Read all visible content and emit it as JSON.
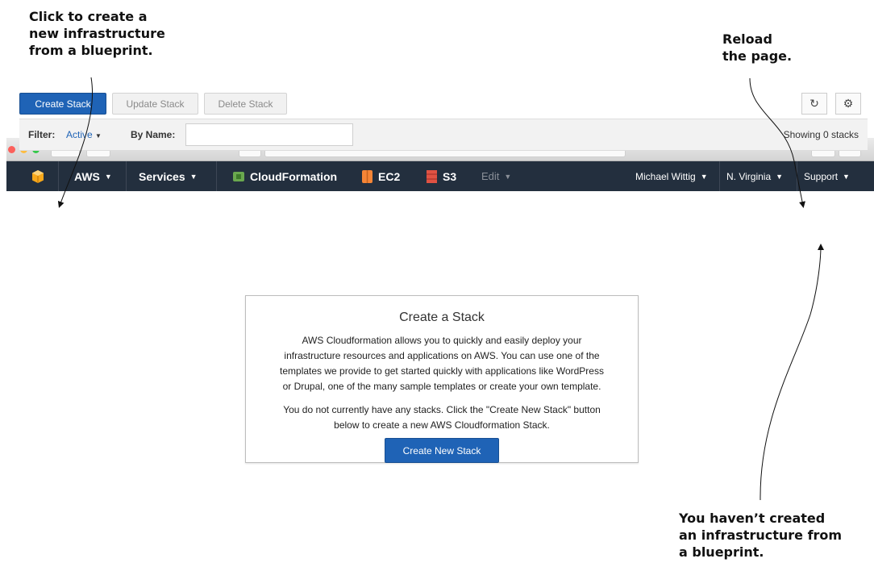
{
  "annotations": {
    "create_callout": "Click to create a\nnew infrastructure\nfrom a blueprint.",
    "reload_callout": "Reload\nthe page.",
    "empty_callout": "You haven’t created\nan infrastructure from\na blueprint."
  },
  "navbar": {
    "aws": "AWS",
    "services": "Services",
    "cloudformation": "CloudFormation",
    "ec2": "EC2",
    "s3": "S3",
    "edit": "Edit",
    "user": "Michael Wittig",
    "region": "N. Virginia",
    "support": "Support"
  },
  "toolbar": {
    "create": "Create Stack",
    "update": "Update Stack",
    "delete": "Delete Stack",
    "reload_icon": "refresh-icon",
    "settings_icon": "gear-icon"
  },
  "filter": {
    "label": "Filter:",
    "value": "Active",
    "by_name": "By Name:",
    "name_value": "",
    "count": "Showing 0 stacks"
  },
  "panel": {
    "title": "Create a Stack",
    "description": "AWS Cloudformation allows you to quickly and easily deploy your\ninfrastructure resources and applications on AWS. You can use one of the\ntemplates we provide to get started quickly with applications like WordPress\nor Drupal, one of the many sample templates or create your own template.",
    "empty_message": "You do not currently have any stacks. Click the \"Create New Stack\" button\nbelow to create a new AWS Cloudformation Stack.",
    "button": "Create New Stack"
  },
  "colors": {
    "navbar": "#232f3e",
    "primary": "#1f63b6",
    "cloudformation_icon": "#6aa84f",
    "ec2_icon": "#f58536",
    "s3_icon": "#e05243"
  }
}
